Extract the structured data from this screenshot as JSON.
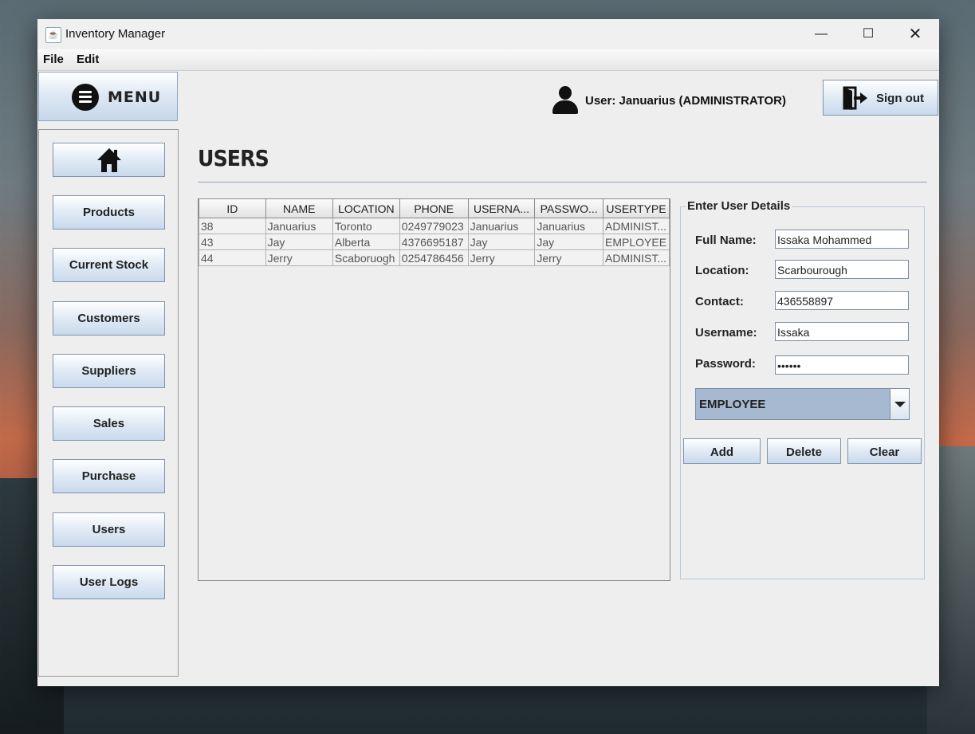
{
  "window": {
    "title": "Inventory Manager",
    "controls": {
      "minimize": "—",
      "maximize": "☐",
      "close": "✕"
    }
  },
  "menubar": {
    "items": [
      "File",
      "Edit"
    ]
  },
  "menu_header": {
    "label": "MENU"
  },
  "sidebar": {
    "home_icon": "home-icon",
    "items": [
      "Products",
      "Current Stock",
      "Customers",
      "Suppliers",
      "Sales",
      "Purchase",
      "Users",
      "User Logs"
    ]
  },
  "header": {
    "user_label": "User: Januarius (ADMINISTRATOR)",
    "signout_label": "Sign out"
  },
  "page": {
    "title": "USERS"
  },
  "table": {
    "columns": [
      "ID",
      "NAME",
      "LOCATION",
      "PHONE",
      "USERNA...",
      "PASSWO...",
      "USERTYPE"
    ],
    "rows": [
      [
        "38",
        "Januarius",
        "Toronto",
        "0249779023",
        "Januarius",
        "Januarius",
        "ADMINIST..."
      ],
      [
        "43",
        "Jay",
        "Alberta",
        "4376695187",
        "Jay",
        "Jay",
        "EMPLOYEE"
      ],
      [
        "44",
        "Jerry",
        "Scaboruogh",
        "0254786456",
        "Jerry",
        "Jerry",
        "ADMINIST..."
      ]
    ]
  },
  "form": {
    "title": "Enter User Details",
    "fields": [
      {
        "label": "Full Name:",
        "value": "Issaka Mohammed"
      },
      {
        "label": "Location:",
        "value": "Scarbourough"
      },
      {
        "label": "Contact:",
        "value": "436558897"
      },
      {
        "label": "Username:",
        "value": "Issaka"
      },
      {
        "label": "Password:",
        "value": "••••••"
      }
    ],
    "usertype_selected": "EMPLOYEE",
    "buttons": {
      "add": "Add",
      "delete": "Delete",
      "clear": "Clear"
    }
  },
  "colors": {
    "button_gradient_bottom": "#c9d9ec",
    "button_border": "#7f94b0",
    "combo_bg": "#a6b9d0"
  }
}
